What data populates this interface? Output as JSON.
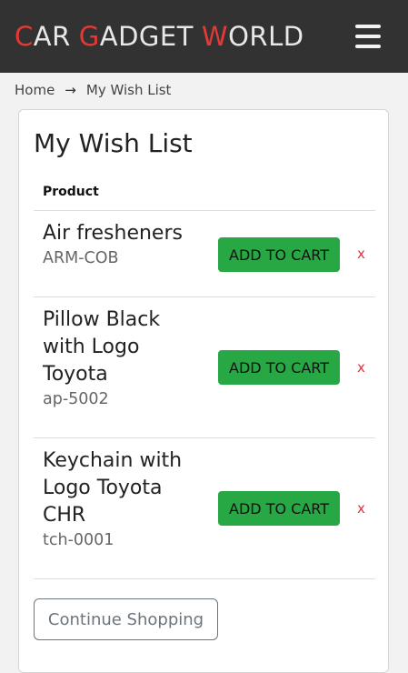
{
  "header": {
    "logo": [
      {
        "first": "C",
        "rest": "AR"
      },
      {
        "first": "G",
        "rest": "ADGET"
      },
      {
        "first": "W",
        "rest": "ORLD"
      }
    ],
    "accent_color": "#e53935",
    "menu_icon": "hamburger-menu-icon"
  },
  "breadcrumb": {
    "home": "Home",
    "separator": "→",
    "current": "My Wish List"
  },
  "wishlist": {
    "title": "My Wish List",
    "column_header": "Product",
    "items": [
      {
        "name": "Air fresheners",
        "sku": "ARM-COB",
        "add_label": "ADD TO CART",
        "remove_label": "x"
      },
      {
        "name": "Pillow Black with Logo Toyota",
        "sku": "ap-5002",
        "add_label": "ADD TO CART",
        "remove_label": "x"
      },
      {
        "name": "Keychain with Logo Toyota CHR",
        "sku": "tch-0001",
        "add_label": "ADD TO CART",
        "remove_label": "x"
      }
    ],
    "continue_label": "Continue Shopping"
  },
  "colors": {
    "navbar_bg": "#333232",
    "add_button": "#28a745",
    "remove": "#dc3545"
  }
}
